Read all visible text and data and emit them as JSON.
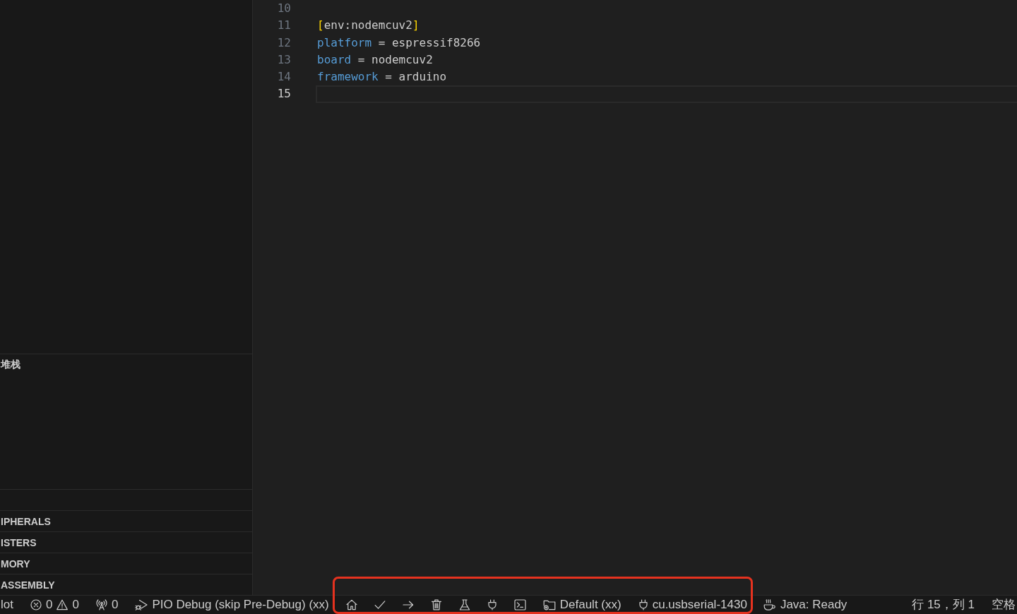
{
  "sidebar": {
    "stack_section": {
      "title": "堆栈"
    },
    "collapsed_sections": [
      {
        "title": "IPHERALS"
      },
      {
        "title": "ISTERS"
      },
      {
        "title": "MORY"
      },
      {
        "title": "ASSEMBLY"
      }
    ]
  },
  "editor": {
    "lines": [
      {
        "number": "10",
        "current": false
      },
      {
        "number": "11",
        "current": false,
        "tokens": [
          {
            "kind": "bracket",
            "text": "["
          },
          {
            "kind": "section",
            "text": "env:nodemcuv2"
          },
          {
            "kind": "bracket",
            "text": "]"
          }
        ]
      },
      {
        "number": "12",
        "current": false,
        "tokens": [
          {
            "kind": "key",
            "text": "platform"
          },
          {
            "kind": "plain",
            "text": " = espressif8266"
          }
        ]
      },
      {
        "number": "13",
        "current": false,
        "tokens": [
          {
            "kind": "key",
            "text": "board"
          },
          {
            "kind": "plain",
            "text": " = nodemcuv2"
          }
        ]
      },
      {
        "number": "14",
        "current": false,
        "tokens": [
          {
            "kind": "key",
            "text": "framework"
          },
          {
            "kind": "plain",
            "text": " = arduino"
          }
        ]
      },
      {
        "number": "15",
        "current": true
      }
    ]
  },
  "status_bar": {
    "groups": [
      {
        "highlighted": false,
        "items": [
          {
            "kind": "text",
            "text": "lot"
          },
          {
            "kind": "problems",
            "errors": "0",
            "warnings": "0"
          },
          {
            "kind": "ports",
            "text": "0"
          },
          {
            "kind": "debug",
            "text": "PIO Debug (skip Pre-Debug) (xx)"
          }
        ]
      },
      {
        "highlighted": true,
        "items": [
          {
            "kind": "home"
          },
          {
            "kind": "check"
          },
          {
            "kind": "arrow"
          },
          {
            "kind": "trash"
          },
          {
            "kind": "flask"
          },
          {
            "kind": "plug"
          },
          {
            "kind": "terminal"
          },
          {
            "kind": "environment",
            "text": "Default (xx)"
          },
          {
            "kind": "serial_port",
            "text": "cu.usbserial-1430"
          }
        ]
      },
      {
        "highlighted": false,
        "items": [
          {
            "kind": "java",
            "text": "Java: Ready"
          },
          {
            "kind": "cursor",
            "text": "行 15，列 1"
          },
          {
            "kind": "indent",
            "text": "空格"
          }
        ]
      }
    ]
  }
}
